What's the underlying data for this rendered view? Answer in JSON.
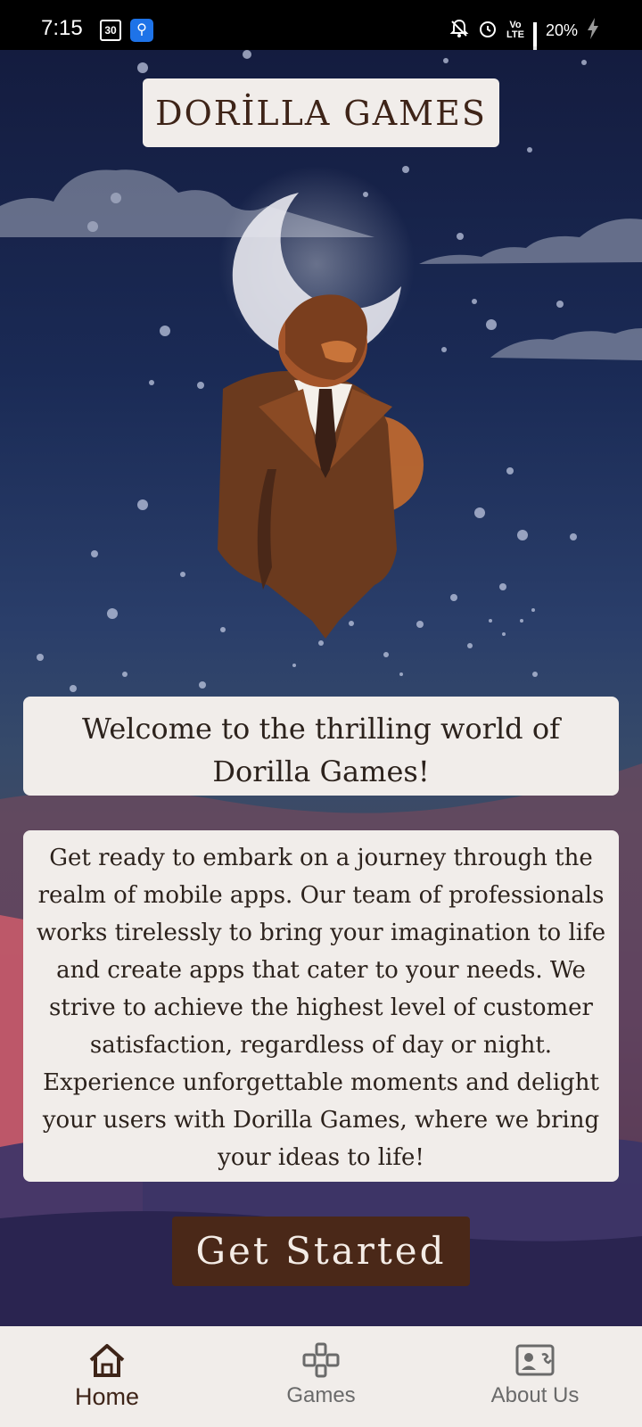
{
  "status_bar": {
    "time": "7:15",
    "calendar_day": "30",
    "volte_label_top": "Vo",
    "volte_label_bottom": "LTE",
    "battery_percent": "20%"
  },
  "header": {
    "logo_text": "DORİLLA GAMES"
  },
  "main": {
    "welcome_text": "Welcome to the thrilling world of Dorilla Games!",
    "description": "Get ready to embark on a journey through the realm of mobile apps. Our team of professionals works tirelessly to bring your imagination to life and create apps that cater to your needs. We strive to achieve the highest level of customer satisfaction, regardless of day or night. Experience unforgettable moments and delight your users with Dorilla Games, where we bring your ideas to life!",
    "cta_label": "Get Started"
  },
  "bottom_nav": {
    "items": [
      {
        "label": "Home",
        "icon": "home-icon",
        "active": true
      },
      {
        "label": "Games",
        "icon": "gamepad-icon",
        "active": false
      },
      {
        "label": "About Us",
        "icon": "contact-card-icon",
        "active": false
      }
    ]
  },
  "colors": {
    "brand_brown": "#4a2818",
    "card_bg": "#f1edea",
    "night_sky": "#141c3f"
  }
}
